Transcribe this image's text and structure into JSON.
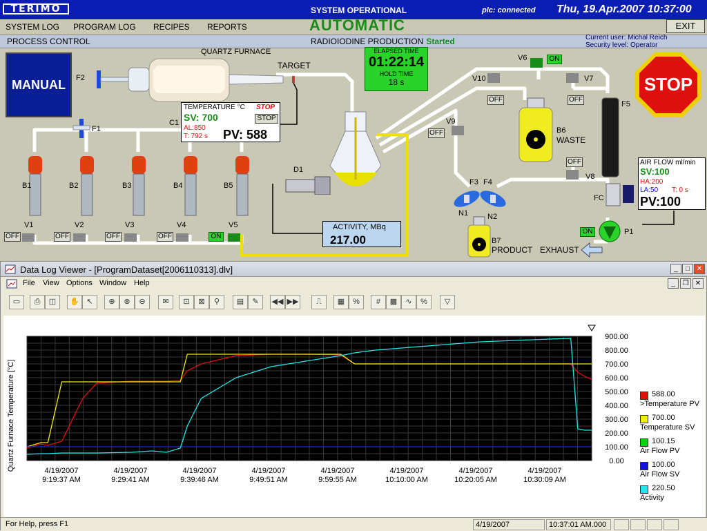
{
  "header": {
    "logo": "TERIMO",
    "system_status": "SYSTEM OPERATIONAL",
    "plc_status": "plc: connected",
    "datetime": "Thu, 19.Apr.2007 10:37:00"
  },
  "menu": {
    "items": [
      "SYSTEM LOG",
      "PROGRAM LOG",
      "RECIPES",
      "REPORTS"
    ],
    "mode": "AUTOMATIC",
    "exit": "EXIT"
  },
  "process_bar": {
    "label": "PROCESS CONTROL",
    "production": "RADIOIODINE PRODUCTION",
    "production_state": "Started",
    "user_line": "Current user: Michal Reich",
    "security_line": "Security level: Operator"
  },
  "manual_button": "MANUAL",
  "stop_button": "STOP",
  "elapsed": {
    "label": "ELAPSED TIME",
    "value": "01:22:14",
    "hold_label": "HOLD TIME",
    "hold_value": "18 s"
  },
  "furnace": {
    "title": "QUARTZ FURNACE",
    "target": "TARGET",
    "temp_label": "TEMPERATURE °C",
    "stop_flag": "STOP",
    "stop_btn": "STOP",
    "sv": "SV: 700",
    "al": "AL:850",
    "t": "T: 792 s",
    "pv": "PV: 588",
    "controller": "C1"
  },
  "activity": {
    "label": "ACTIVITY, MBq",
    "value": "217.00",
    "detector": "D1"
  },
  "airflow": {
    "label": "AIR FLOW ml/min",
    "sv": "SV:100",
    "ha": "HA:200",
    "la": "LA:50",
    "t": "T: 0 s",
    "pv": "PV:100"
  },
  "diagram_labels": {
    "f1": "F1",
    "f2": "F2",
    "f3": "F3",
    "f4": "F4",
    "f5": "F5",
    "fc": "FC",
    "b1": "B1",
    "b2": "B2",
    "b3": "B3",
    "b4": "B4",
    "b5": "B5",
    "b6": "B6",
    "waste": "WASTE",
    "b7": "B7",
    "product": "PRODUCT",
    "n1": "N1",
    "n2": "N2",
    "p1": "P1",
    "exhaust": "EXHAUST",
    "v1": "V1",
    "v2": "V2",
    "v3": "V3",
    "v4": "V4",
    "v5": "V5",
    "v6": "V6",
    "v7": "V7",
    "v8": "V8",
    "v9": "V9",
    "v10": "V10"
  },
  "valve_states": {
    "v1": "OFF",
    "v2": "OFF",
    "v3": "OFF",
    "v4": "OFF",
    "v5": "ON",
    "v6": "ON",
    "v7": "OFF",
    "v8": "OFF",
    "v9": "OFF",
    "v10": "OFF",
    "p1": "ON"
  },
  "viewer": {
    "title": "Data Log Viewer - [ProgramDataset[2006110313].dlv]",
    "menu": [
      "File",
      "View",
      "Options",
      "Window",
      "Help"
    ],
    "status_help": "For Help, press F1",
    "status_date": "4/19/2007",
    "status_time": "10:37:01 AM.000"
  },
  "legend": [
    {
      "value": "588.00",
      "name": ">Temperature PV",
      "color": "#e01010"
    },
    {
      "value": "700.00",
      "name": "Temperature SV",
      "color": "#f0f010"
    },
    {
      "value": "100.15",
      "name": "Air Flow PV",
      "color": "#10d010"
    },
    {
      "value": "100.00",
      "name": "Air Flow SV",
      "color": "#1010e0"
    },
    {
      "value": "220.50",
      "name": "Activity",
      "color": "#20e8e8"
    }
  ],
  "chart_data": {
    "type": "line",
    "ylabel": "Quartz Furnace Temperature [°C]",
    "ylim": [
      0,
      900
    ],
    "yticks": [
      "900.00",
      "800.00",
      "700.00",
      "600.00",
      "500.00",
      "400.00",
      "300.00",
      "200.00",
      "100.00",
      "0.00"
    ],
    "xlabels": [
      [
        "4/19/2007",
        "9:19:37 AM"
      ],
      [
        "4/19/2007",
        "9:29:41 AM"
      ],
      [
        "4/19/2007",
        "9:39:46 AM"
      ],
      [
        "4/19/2007",
        "9:49:51 AM"
      ],
      [
        "4/19/2007",
        "9:59:55 AM"
      ],
      [
        "4/19/2007",
        "10:10:00 AM"
      ],
      [
        "4/19/2007",
        "10:20:05 AM"
      ],
      [
        "4/19/2007",
        "10:30:09 AM"
      ]
    ],
    "x_minutes": [
      0,
      2,
      3,
      5,
      8,
      10,
      15,
      18,
      20,
      22,
      23,
      25,
      30,
      35,
      40,
      45,
      47,
      50,
      55,
      60,
      65,
      70,
      75,
      78,
      79,
      80,
      81
    ],
    "series": [
      {
        "name": "Temperature PV",
        "color": "#e01010",
        "values": [
          90,
          120,
          110,
          140,
          450,
          560,
          575,
          575,
          575,
          580,
          650,
          700,
          760,
          770,
          770,
          765,
          700,
          700,
          700,
          700,
          700,
          700,
          700,
          700,
          640,
          610,
          588
        ]
      },
      {
        "name": "Temperature SV",
        "color": "#f0f010",
        "values": [
          100,
          130,
          130,
          570,
          570,
          570,
          570,
          570,
          570,
          570,
          770,
          770,
          770,
          770,
          770,
          770,
          700,
          700,
          700,
          700,
          700,
          700,
          700,
          700,
          700,
          700,
          700
        ]
      },
      {
        "name": "Air Flow PV",
        "color": "#10d010",
        "values": [
          100,
          100,
          100,
          100,
          100,
          100,
          100,
          100,
          100,
          100,
          100,
          100,
          100,
          100,
          100,
          100,
          100,
          100,
          100,
          100,
          100,
          100,
          100,
          100,
          100,
          100,
          100
        ]
      },
      {
        "name": "Air Flow SV",
        "color": "#1010e0",
        "values": [
          100,
          100,
          100,
          100,
          100,
          100,
          100,
          100,
          100,
          100,
          100,
          100,
          100,
          100,
          100,
          100,
          100,
          100,
          100,
          100,
          100,
          100,
          100,
          100,
          100,
          100,
          100
        ]
      },
      {
        "name": "Activity",
        "color": "#20e8e8",
        "values": [
          45,
          50,
          50,
          55,
          55,
          55,
          60,
          70,
          60,
          90,
          250,
          450,
          600,
          680,
          720,
          760,
          780,
          800,
          820,
          840,
          860,
          870,
          880,
          885,
          230,
          220,
          220
        ]
      }
    ]
  }
}
